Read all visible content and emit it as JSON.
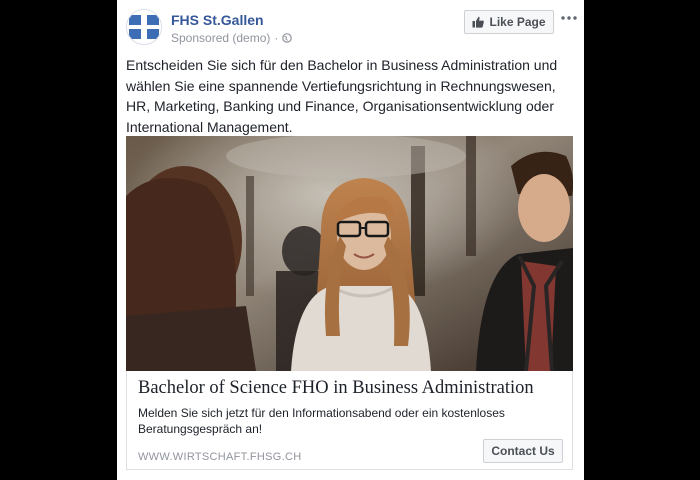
{
  "post": {
    "page_name": "FHS St.Gallen",
    "sponsored_label": "Sponsored (demo)",
    "separator": "·",
    "privacy_icon": "globe-icon",
    "like_button_label": "Like Page",
    "like_icon": "thumbs-up-icon",
    "more_icon": "more-dots-icon",
    "body_text": "Entscheiden Sie sich für den Bachelor in Business Administration und wählen Sie eine spannende Vertiefungsrichtung in Rechnungswesen, HR, Marketing, Banking und Finance, Organisationsentwicklung oder International Management."
  },
  "ad": {
    "headline": "Bachelor of Science FHO in Business Administration",
    "description": "Melden Sie sich jetzt für den Informationsabend oder ein kostenloses Beratungsgespräch an!",
    "domain": "WWW.WIRTSCHAFT.FHSG.CH",
    "cta_label": "Contact Us"
  },
  "colors": {
    "brand_blue": "#365899",
    "logo_blue": "#3d6db5",
    "text": "#1d2129",
    "muted": "#90949c"
  }
}
